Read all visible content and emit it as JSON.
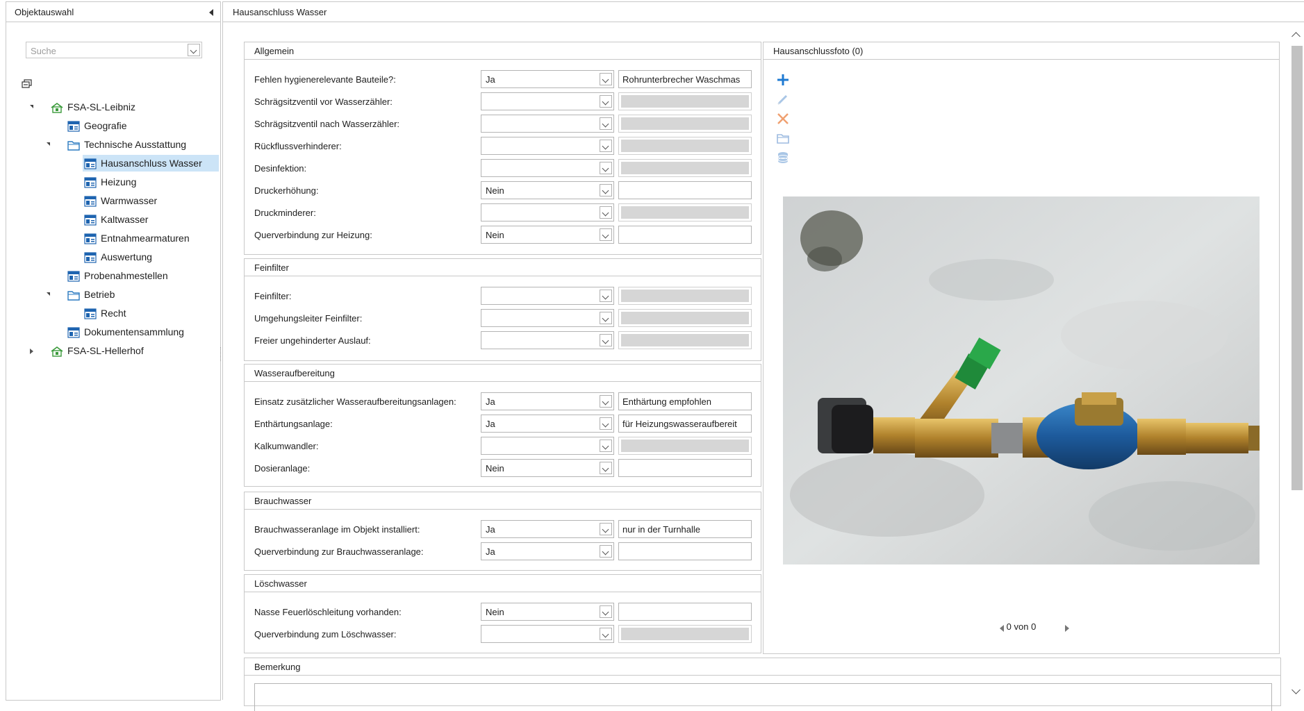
{
  "left_panel": {
    "title": "Objektauswahl",
    "search_placeholder": "Suche",
    "tree": [
      {
        "label": "FSA-SL-Leibniz",
        "level": 0,
        "expander": "open",
        "icon": "building-icon"
      },
      {
        "label": "Geografie",
        "level": 1,
        "expander": "none",
        "icon": "form-icon"
      },
      {
        "label": "Technische Ausstattung",
        "level": 1,
        "expander": "open",
        "icon": "folder-icon"
      },
      {
        "label": "Hausanschluss Wasser",
        "level": 2,
        "expander": "none",
        "icon": "form-icon",
        "selected": true
      },
      {
        "label": "Heizung",
        "level": 2,
        "expander": "none",
        "icon": "form-icon"
      },
      {
        "label": "Warmwasser",
        "level": 2,
        "expander": "none",
        "icon": "form-icon"
      },
      {
        "label": "Kaltwasser",
        "level": 2,
        "expander": "none",
        "icon": "form-icon"
      },
      {
        "label": "Entnahmearmaturen",
        "level": 2,
        "expander": "none",
        "icon": "form-icon"
      },
      {
        "label": "Auswertung",
        "level": 2,
        "expander": "none",
        "icon": "form-icon"
      },
      {
        "label": "Probenahmestellen",
        "level": 1,
        "expander": "none",
        "icon": "form-icon"
      },
      {
        "label": "Betrieb",
        "level": 1,
        "expander": "open",
        "icon": "folder-icon"
      },
      {
        "label": "Recht",
        "level": 2,
        "expander": "none",
        "icon": "form-icon"
      },
      {
        "label": "Dokumentensammlung",
        "level": 1,
        "expander": "none",
        "icon": "form-icon"
      },
      {
        "label": "FSA-SL-Hellerhof",
        "level": 0,
        "expander": "closed",
        "icon": "building-icon"
      }
    ]
  },
  "main": {
    "title": "Hausanschluss Wasser",
    "groups": {
      "allgemein": {
        "title": "Allgemein",
        "rows": [
          {
            "label": "Fehlen hygienerelevante Bauteile?:",
            "select": "Ja",
            "text": "Rohrunterbrecher Waschmas",
            "text_disabled": false
          },
          {
            "label": "Schrägsitzventil vor Wasserzähler:",
            "select": "",
            "text": "",
            "text_disabled": true
          },
          {
            "label": "Schrägsitzventil nach Wasserzähler:",
            "select": "",
            "text": "",
            "text_disabled": true
          },
          {
            "label": "Rückflussverhinderer:",
            "select": "",
            "text": "",
            "text_disabled": true
          },
          {
            "label": "Desinfektion:",
            "select": "",
            "text": "",
            "text_disabled": true
          },
          {
            "label": "Druckerhöhung:",
            "select": "Nein",
            "text": "",
            "text_disabled": false
          },
          {
            "label": "Druckminderer:",
            "select": "",
            "text": "",
            "text_disabled": true
          },
          {
            "label": "Querverbindung zur Heizung:",
            "select": "Nein",
            "text": "",
            "text_disabled": false
          }
        ]
      },
      "feinfilter": {
        "title": "Feinfilter",
        "rows": [
          {
            "label": "Feinfilter:",
            "select": "",
            "text": "",
            "text_disabled": true
          },
          {
            "label": "Umgehungsleiter Feinfilter:",
            "select": "",
            "text": "",
            "text_disabled": true
          },
          {
            "label": "Freier ungehinderter Auslauf:",
            "select": "",
            "text": "",
            "text_disabled": true
          }
        ]
      },
      "wasseraufbereitung": {
        "title": "Wasseraufbereitung",
        "rows": [
          {
            "label": "Einsatz zusätzlicher Wasseraufbereitungsanlagen:",
            "select": "Ja",
            "text": "Enthärtung empfohlen",
            "text_disabled": false
          },
          {
            "label": "Enthärtungsanlage:",
            "select": "Ja",
            "text": "für Heizungswasseraufbereit",
            "text_disabled": false
          },
          {
            "label": "Kalkumwandler:",
            "select": "",
            "text": "",
            "text_disabled": true
          },
          {
            "label": "Dosieranlage:",
            "select": "Nein",
            "text": "",
            "text_disabled": false
          }
        ]
      },
      "brauchwasser": {
        "title": "Brauchwasser",
        "rows": [
          {
            "label": "Brauchwasseranlage im Objekt installiert:",
            "select": "Ja",
            "text": "nur in der Turnhalle",
            "text_disabled": false
          },
          {
            "label": "Querverbindung zur Brauchwasseranlage:",
            "select": "Ja",
            "text": "",
            "text_disabled": false
          }
        ]
      },
      "loeschwasser": {
        "title": "Löschwasser",
        "rows": [
          {
            "label": "Nasse Feuerlöschleitung vorhanden:",
            "select": "Nein",
            "text": "",
            "text_disabled": false
          },
          {
            "label": "Querverbindung zum Löschwasser:",
            "select": "",
            "text": "",
            "text_disabled": true
          }
        ]
      },
      "bemerkung": {
        "title": "Bemerkung"
      }
    },
    "photo": {
      "title": "Hausanschlussfoto (0)",
      "pager": "0 von 0",
      "tools": [
        "add-icon",
        "edit-icon",
        "delete-icon",
        "folder-open-icon",
        "database-icon"
      ]
    }
  },
  "colors": {
    "selection": "#cce4f7",
    "accent_blue": "#1e7ad2",
    "delete_orange": "#f0a070",
    "building_green": "#3a9a3a"
  }
}
